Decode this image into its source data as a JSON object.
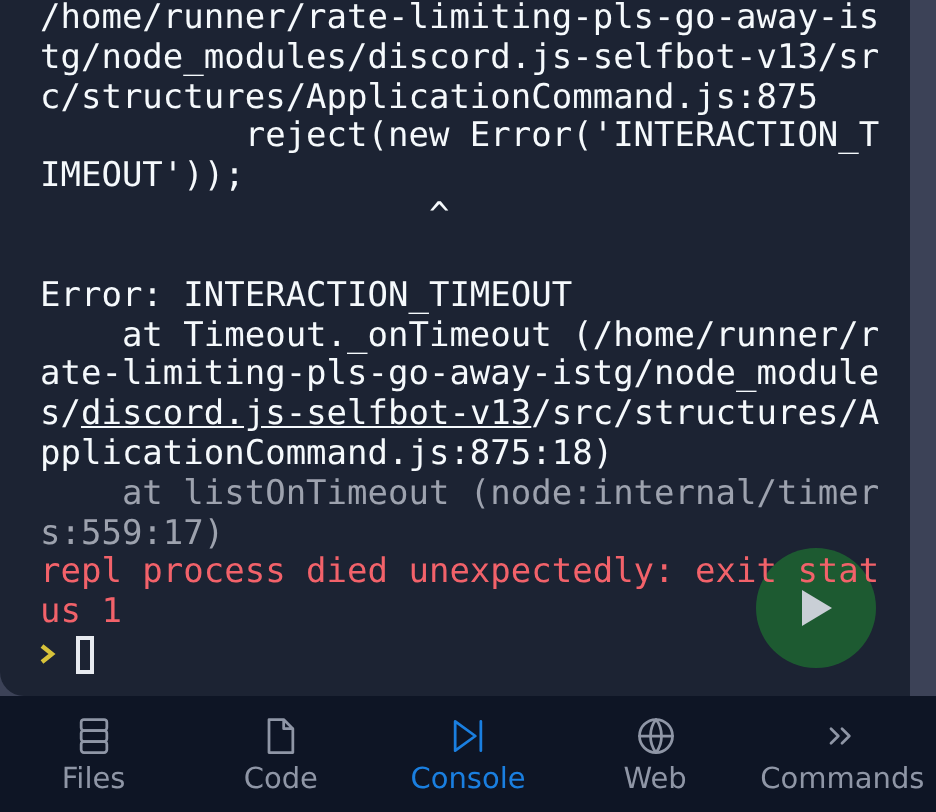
{
  "console": {
    "lines": [
      {
        "kind": "normal",
        "parts": [
          {
            "kind": "plain",
            "text": "/home/runner/rate-limiting-pls-go-away-is"
          }
        ]
      },
      {
        "kind": "normal",
        "parts": [
          {
            "kind": "plain",
            "text": "tg/node_modules/discord.js-selfbot-v13/sr"
          }
        ]
      },
      {
        "kind": "normal",
        "parts": [
          {
            "kind": "plain",
            "text": "c/structures/ApplicationCommand.js:875"
          }
        ]
      },
      {
        "kind": "normal",
        "parts": [
          {
            "kind": "plain",
            "text": "          reject(new Error('INTERACTION_T"
          }
        ]
      },
      {
        "kind": "normal",
        "parts": [
          {
            "kind": "plain",
            "text": "IMEOUT'));"
          }
        ]
      },
      {
        "kind": "normal",
        "parts": [
          {
            "kind": "plain",
            "text": "                   ^"
          }
        ]
      },
      {
        "kind": "heading",
        "parts": [
          {
            "kind": "plain",
            "text": "Error: INTERACTION_TIMEOUT"
          }
        ]
      },
      {
        "kind": "normal",
        "parts": [
          {
            "kind": "plain",
            "text": "    at Timeout._onTimeout (/home/runner/r"
          }
        ]
      },
      {
        "kind": "normal",
        "parts": [
          {
            "kind": "plain",
            "text": "ate-limiting-pls-go-away-istg/node_module"
          }
        ]
      },
      {
        "kind": "normal",
        "parts": [
          {
            "kind": "plain",
            "text": "s/"
          },
          {
            "kind": "link",
            "text": "discord.js-selfbot-v13"
          },
          {
            "kind": "plain",
            "text": "/src/structures/A"
          }
        ]
      },
      {
        "kind": "normal",
        "parts": [
          {
            "kind": "plain",
            "text": "pplicationCommand.js:875:18)"
          }
        ]
      },
      {
        "kind": "dim",
        "parts": [
          {
            "kind": "plain",
            "text": "    at listOnTimeout (node:internal/timer"
          }
        ]
      },
      {
        "kind": "dim",
        "parts": [
          {
            "kind": "plain",
            "text": "s:559:17)"
          }
        ]
      },
      {
        "kind": "error",
        "parts": [
          {
            "kind": "plain",
            "text": "repl process died unexpectedly: exit stat"
          }
        ]
      },
      {
        "kind": "error",
        "parts": [
          {
            "kind": "plain",
            "text": "us 1"
          }
        ]
      }
    ]
  },
  "tabs": [
    {
      "label": "Files",
      "selected": false
    },
    {
      "label": "Code",
      "selected": false
    },
    {
      "label": "Console",
      "selected": true
    },
    {
      "label": "Web",
      "selected": false
    },
    {
      "label": "Commands",
      "selected": false
    }
  ]
}
